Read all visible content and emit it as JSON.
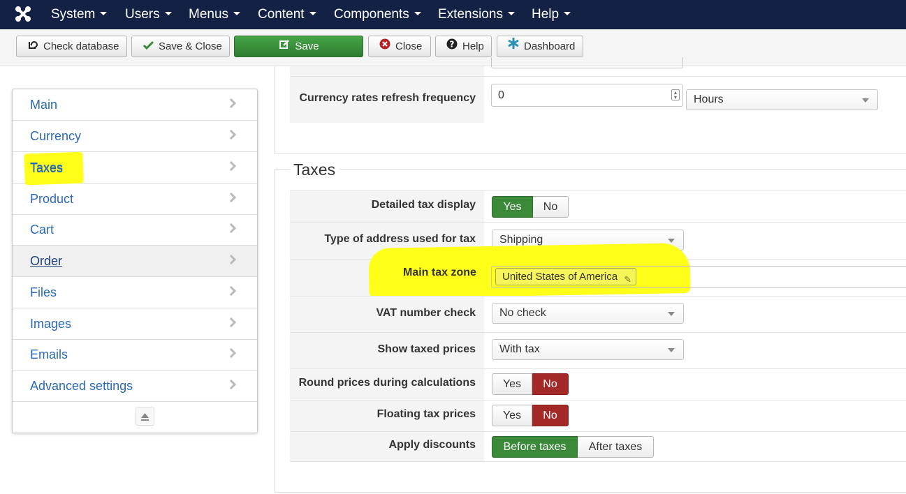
{
  "nav": {
    "menus": [
      {
        "label": "System"
      },
      {
        "label": "Users"
      },
      {
        "label": "Menus"
      },
      {
        "label": "Content"
      },
      {
        "label": "Components"
      },
      {
        "label": "Extensions"
      },
      {
        "label": "Help"
      }
    ]
  },
  "toolbar": {
    "check_database": "Check database",
    "save_close": "Save & Close",
    "save": "Save",
    "close": "Close",
    "help": "Help",
    "dashboard": "Dashboard"
  },
  "sidebar": {
    "items": [
      {
        "label": "Main"
      },
      {
        "label": "Currency"
      },
      {
        "label": "Taxes"
      },
      {
        "label": "Product"
      },
      {
        "label": "Cart"
      },
      {
        "label": "Order"
      },
      {
        "label": "Files"
      },
      {
        "label": "Images"
      },
      {
        "label": "Emails"
      },
      {
        "label": "Advanced settings"
      }
    ],
    "active": "Order",
    "highlighted": "Taxes"
  },
  "currency_section": {
    "refresh_label": "Currency rates refresh frequency",
    "refresh_value": "0",
    "refresh_unit": "Hours"
  },
  "taxes_section": {
    "legend": "Taxes",
    "detailed_tax_display": {
      "label": "Detailed tax display",
      "yes": "Yes",
      "no": "No",
      "selected": "Yes"
    },
    "address_type": {
      "label": "Type of address used for tax",
      "value": "Shipping"
    },
    "main_tax_zone": {
      "label": "Main tax zone",
      "tag": "United States of America"
    },
    "vat_check": {
      "label": "VAT number check",
      "value": "No check"
    },
    "show_taxed_prices": {
      "label": "Show taxed prices",
      "value": "With tax"
    },
    "round_prices": {
      "label": "Round prices during calculations",
      "yes": "Yes",
      "no": "No",
      "selected": "No"
    },
    "floating_tax": {
      "label": "Floating tax prices",
      "yes": "Yes",
      "no": "No",
      "selected": "No"
    },
    "apply_discounts": {
      "label": "Apply discounts",
      "before": "Before taxes",
      "after": "After taxes",
      "selected": "Before taxes"
    }
  },
  "colors": {
    "nav_bg": "#132244",
    "save_green": "#3a8a3a",
    "no_red": "#a32929",
    "link_blue": "#2a69b8",
    "highlight_yellow": "#ffff1a"
  }
}
